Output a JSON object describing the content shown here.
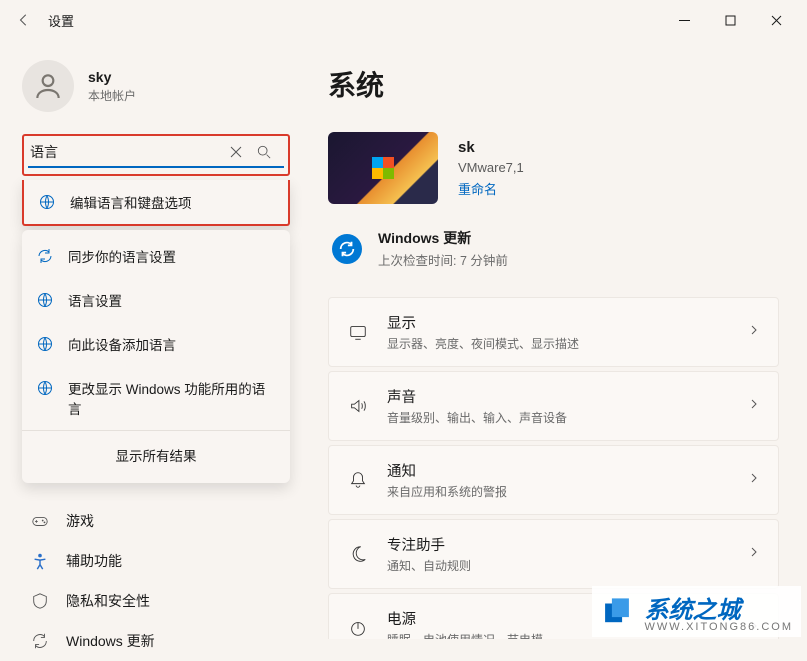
{
  "window": {
    "title": "设置"
  },
  "user": {
    "name": "sky",
    "subtitle": "本地帐户"
  },
  "search": {
    "value": "语言"
  },
  "suggestions": [
    {
      "icon": "globe-cursor",
      "label": "编辑语言和键盘选项"
    },
    {
      "icon": "sync",
      "label": "同步你的语言设置"
    },
    {
      "icon": "globe-cursor",
      "label": "语言设置"
    },
    {
      "icon": "globe-cursor",
      "label": "向此设备添加语言"
    },
    {
      "icon": "globe-cursor",
      "label": "更改显示 Windows 功能所用的语言"
    }
  ],
  "suggestions_more": "显示所有结果",
  "nav": [
    {
      "icon": "gamepad",
      "label": "游戏"
    },
    {
      "icon": "accessibility",
      "label": "辅助功能"
    },
    {
      "icon": "shield",
      "label": "隐私和安全性"
    },
    {
      "icon": "update",
      "label": "Windows 更新"
    }
  ],
  "page": {
    "title": "系统"
  },
  "pc": {
    "name": "sk",
    "model": "VMware7,1",
    "rename": "重命名"
  },
  "update": {
    "title": "Windows 更新",
    "subtitle": "上次检查时间: 7 分钟前"
  },
  "settings": [
    {
      "icon": "display",
      "title": "显示",
      "sub": "显示器、亮度、夜间模式、显示描述"
    },
    {
      "icon": "sound",
      "title": "声音",
      "sub": "音量级别、输出、输入、声音设备"
    },
    {
      "icon": "bell",
      "title": "通知",
      "sub": "来自应用和系统的警报"
    },
    {
      "icon": "moon",
      "title": "专注助手",
      "sub": "通知、自动规则"
    },
    {
      "icon": "power",
      "title": "电源",
      "sub": "睡眠、电池使用情况、节电模…"
    }
  ],
  "watermark": {
    "main": "系统之城",
    "sub": "WWW.XITONG86.COM"
  }
}
